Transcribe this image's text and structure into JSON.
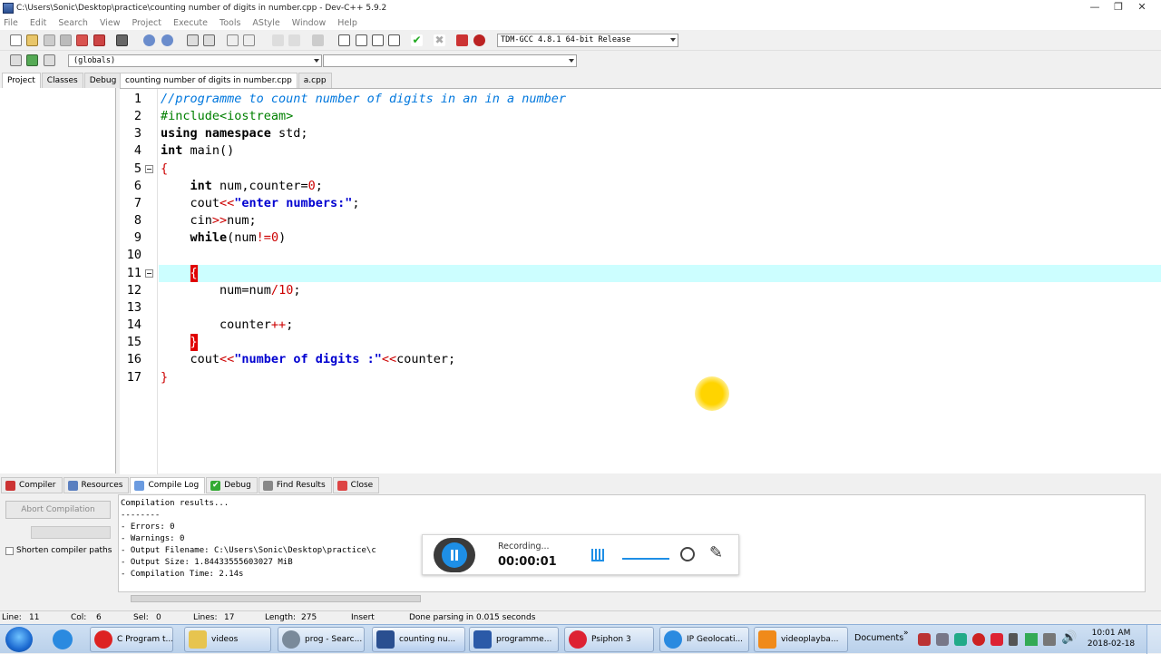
{
  "window": {
    "title": "C:\\Users\\Sonic\\Desktop\\practice\\counting number of digits in number.cpp - Dev-C++ 5.9.2"
  },
  "menu": [
    "File",
    "Edit",
    "Search",
    "View",
    "Project",
    "Execute",
    "Tools",
    "AStyle",
    "Window",
    "Help"
  ],
  "toolbar": {
    "compiler": "TDM-GCC 4.8.1 64-bit Release",
    "scope": "(globals)"
  },
  "left_tabs": [
    "Project",
    "Classes",
    "Debug"
  ],
  "editor_tabs": [
    "counting number of digits in number.cpp",
    "a.cpp"
  ],
  "editor": {
    "line_numbers": [
      "1",
      "2",
      "3",
      "4",
      "5",
      "6",
      "7",
      "8",
      "9",
      "10",
      "11",
      "12",
      "13",
      "14",
      "15",
      "16",
      "17"
    ],
    "code": {
      "l1": "//programme to count number of digits in an in a number",
      "l2": "#include<iostream>",
      "l3a": "using namespace",
      "l3b": " std;",
      "l4a": "int",
      "l4b": " main()",
      "l5": "{",
      "l6a": "    int",
      "l6b": " num,counter=",
      "l6c": "0",
      "l6d": ";",
      "l7a": "    cout",
      "l7b": "<<",
      "l7c": "\"enter numbers:\"",
      "l7d": ";",
      "l8a": "    cin",
      "l8b": ">>",
      "l8c": "num;",
      "l9a": "    while",
      "l9b": "(num",
      "l9c": "!=",
      "l9d": "0",
      "l9e": ")",
      "l11": "{",
      "l12a": "        num=num",
      "l12b": "/",
      "l12c": "10",
      "l12d": ";",
      "l14a": "        counter",
      "l14b": "++",
      "l14c": ";",
      "l15": "}",
      "l16a": "    cout",
      "l16b": "<<",
      "l16c": "\"number of digits :\"",
      "l16d": "<<",
      "l16e": "counter;",
      "l17": "}"
    }
  },
  "bottom_tabs": [
    "Compiler",
    "Resources",
    "Compile Log",
    "Debug",
    "Find Results",
    "Close"
  ],
  "bottom_panel": {
    "abort_label": "Abort Compilation",
    "shorten_label": "Shorten compiler paths",
    "log": [
      "Compilation results...",
      "--------",
      "- Errors: 0",
      "- Warnings: 0",
      "- Output Filename: C:\\Users\\Sonic\\Desktop\\practice\\c",
      "- Output Size: 1.84433555603027 MiB",
      "- Compilation Time: 2.14s"
    ]
  },
  "recorder": {
    "status": "Recording...",
    "time": "00:00:01"
  },
  "statusbar": {
    "line_label": "Line:",
    "line_value": "11",
    "col_label": "Col:",
    "col_value": "6",
    "sel_label": "Sel:",
    "sel_value": "0",
    "lines_label": "Lines:",
    "lines_value": "17",
    "length_label": "Length:",
    "length_value": "275",
    "mode": "Insert",
    "message": "Done parsing in 0.015 seconds"
  },
  "taskbar": {
    "tasks": [
      "C Program t...",
      "videos",
      "prog - Searc...",
      "counting nu...",
      "programme...",
      "Psiphon 3",
      "IP Geolocati...",
      "videoplayba..."
    ],
    "documents": "Documents",
    "time": "10:01 AM",
    "date": "2018-02-18"
  }
}
